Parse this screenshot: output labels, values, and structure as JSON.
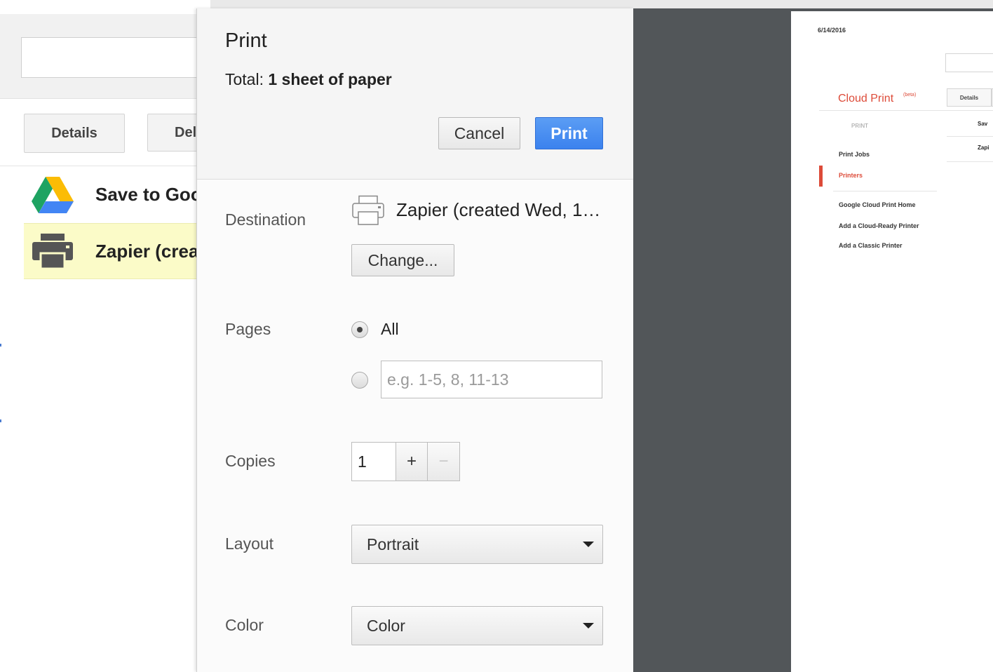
{
  "background_page": {
    "details_label": "Details",
    "delete_label": "Del",
    "printers": [
      {
        "name": "Save to Goo",
        "icon": "google-drive-icon"
      },
      {
        "name": "Zapier (crea",
        "icon": "printer-icon",
        "selected": true
      }
    ]
  },
  "dialog": {
    "title": "Print",
    "total_label": "Total:",
    "total_value": "1 sheet of paper",
    "cancel_label": "Cancel",
    "print_label": "Print",
    "destination": {
      "label": "Destination",
      "name": "Zapier (created Wed, 1…",
      "change_label": "Change..."
    },
    "pages": {
      "label": "Pages",
      "all_label": "All",
      "selected": "all",
      "custom_placeholder": "e.g. 1-5, 8, 11-13"
    },
    "copies": {
      "label": "Copies",
      "value": "1",
      "plus": "+",
      "minus": "−"
    },
    "layout": {
      "label": "Layout",
      "value": "Portrait"
    },
    "color": {
      "label": "Color",
      "value": "Color"
    }
  },
  "preview": {
    "date": "6/14/2016",
    "title": "Cloud Print",
    "beta": "(beta)",
    "details": "Details",
    "section": "PRINT",
    "nav": [
      "Print Jobs",
      "Printers"
    ],
    "links": [
      "Google Cloud Print Home",
      "Add a Cloud-Ready Printer",
      "Add a Classic Printer"
    ],
    "list": [
      "Sav",
      "Zapi"
    ]
  },
  "colors": {
    "accent_blue": "#3b82ee",
    "preview_bg": "#525659",
    "cloud_print_red": "#dd4b39",
    "selected_row": "#fbfbc8"
  }
}
